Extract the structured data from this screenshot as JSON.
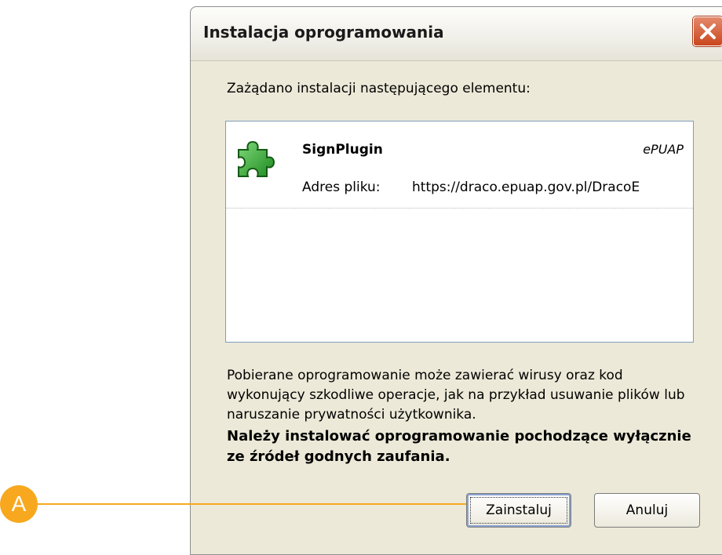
{
  "dialog": {
    "title": "Instalacja oprogramowania",
    "intro": "Zażądano instalacji następującego elementu:",
    "item": {
      "name": "SignPlugin",
      "publisher": "ePUAP",
      "address_label": "Adres pliku:",
      "address_value": "https://draco.epuap.gov.pl/DracoE",
      "icon": "puzzle-piece-icon"
    },
    "warning": "Pobierane oprogramowanie może zawierać wirusy oraz kod wykonujący szkodliwe operacje, jak na przykład usuwanie plików lub naruszanie prywatności użytkownika.",
    "strong_warning": "Należy instalować oprogramowanie pochodzące wyłącznie ze źródeł godnych zaufania.",
    "buttons": {
      "install": "Zainstaluj",
      "cancel": "Anuluj"
    }
  },
  "annotation": {
    "marker_label": "A",
    "color": "#f7a81f"
  }
}
